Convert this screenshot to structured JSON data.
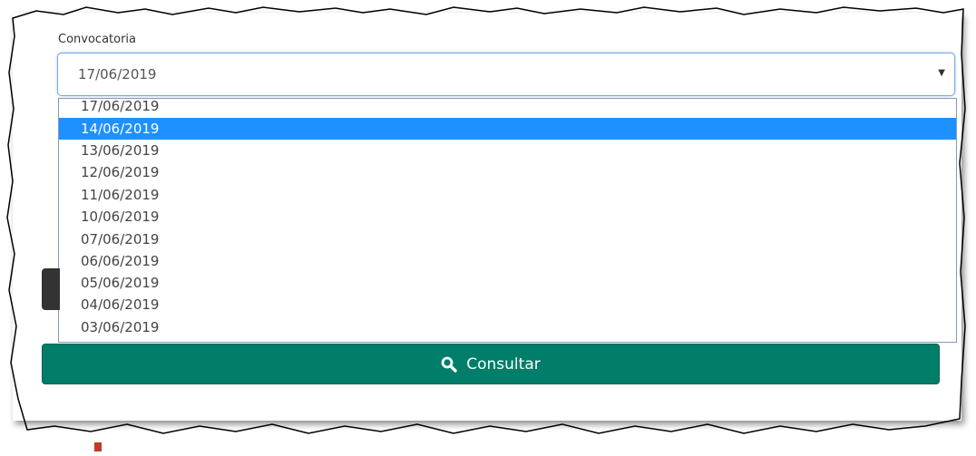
{
  "form": {
    "label": "Convocatoria",
    "selected_value": "17/06/2019",
    "dropdown_options": [
      "17/06/2019",
      "14/06/2019",
      "13/06/2019",
      "12/06/2019",
      "11/06/2019",
      "10/06/2019",
      "07/06/2019",
      "06/06/2019",
      "05/06/2019",
      "04/06/2019",
      "03/06/2019"
    ],
    "highlighted_option": "14/06/2019",
    "button_label": "Consultar",
    "button_icon": "search-icon"
  },
  "colors": {
    "highlight": "#1e90ff",
    "button": "#007e69"
  }
}
